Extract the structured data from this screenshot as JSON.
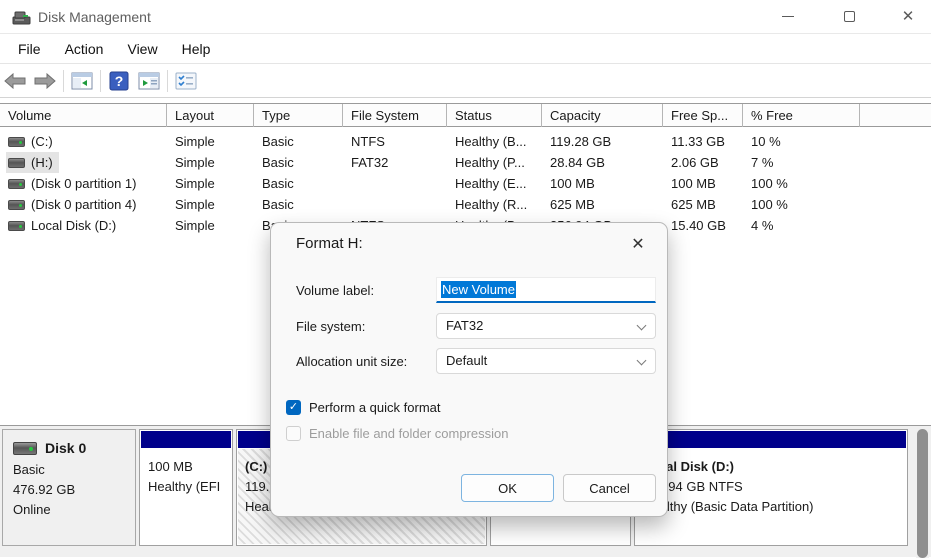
{
  "window": {
    "title": "Disk Management",
    "menus": [
      "File",
      "Action",
      "View",
      "Help"
    ]
  },
  "icons": {
    "close_x": "✕",
    "dialog_close_x": "✕",
    "check": "✓",
    "help_question": "?"
  },
  "colors": {
    "partition_stripe": "#00008b",
    "selection_blue": "#0078d7",
    "accent_blue": "#0067c0",
    "led_green": "#27c840"
  },
  "table": {
    "columns": [
      "Volume",
      "Layout",
      "Type",
      "File System",
      "Status",
      "Capacity",
      "Free Sp...",
      "% Free"
    ],
    "rows": [
      {
        "volume": "(C:)",
        "layout": "Simple",
        "type": "Basic",
        "fs": "NTFS",
        "status": "Healthy (B...",
        "capacity": "119.28 GB",
        "free": "11.33 GB",
        "pct": "10 %"
      },
      {
        "volume": "(H:)",
        "layout": "Simple",
        "type": "Basic",
        "fs": "FAT32",
        "status": "Healthy (P...",
        "capacity": "28.84 GB",
        "free": "2.06 GB",
        "pct": "7 %"
      },
      {
        "volume": "(Disk 0 partition 1)",
        "layout": "Simple",
        "type": "Basic",
        "fs": "",
        "status": "Healthy (E...",
        "capacity": "100 MB",
        "free": "100 MB",
        "pct": "100 %"
      },
      {
        "volume": "(Disk 0 partition 4)",
        "layout": "Simple",
        "type": "Basic",
        "fs": "",
        "status": "Healthy (R...",
        "capacity": "625 MB",
        "free": "625 MB",
        "pct": "100 %"
      },
      {
        "volume": "Local Disk (D:)",
        "layout": "Simple",
        "type": "Basic",
        "fs": "NTFS",
        "status": "Healthy (B...",
        "capacity": "356.94 GB",
        "free": "15.40 GB",
        "pct": "4 %"
      }
    ]
  },
  "graphic": {
    "disk": {
      "name": "Disk 0",
      "type": "Basic",
      "size": "476.92 GB",
      "status": "Online"
    },
    "blocks": [
      {
        "line1": "100 MB",
        "line2": "Healthy (EFI",
        "line3": ""
      },
      {
        "line1": "(C:)",
        "line2": "119.28 GB NTFS",
        "line3": "Healthy (B"
      },
      {
        "line1": "",
        "line2": "",
        "line3": ""
      },
      {
        "line1": "Local Disk  (D:)",
        "line2": "356.94 GB NTFS",
        "line3": "Healthy (Basic Data Partition)"
      }
    ]
  },
  "dialog": {
    "title": "Format H:",
    "volume_label": {
      "label": "Volume label:",
      "value": "New Volume"
    },
    "file_system": {
      "label": "File system:",
      "value": "FAT32"
    },
    "allocation": {
      "label": "Allocation unit size:",
      "value": "Default"
    },
    "quick_format_label": "Perform a quick format",
    "compression_label": "Enable file and folder compression",
    "ok_label": "OK",
    "cancel_label": "Cancel"
  }
}
